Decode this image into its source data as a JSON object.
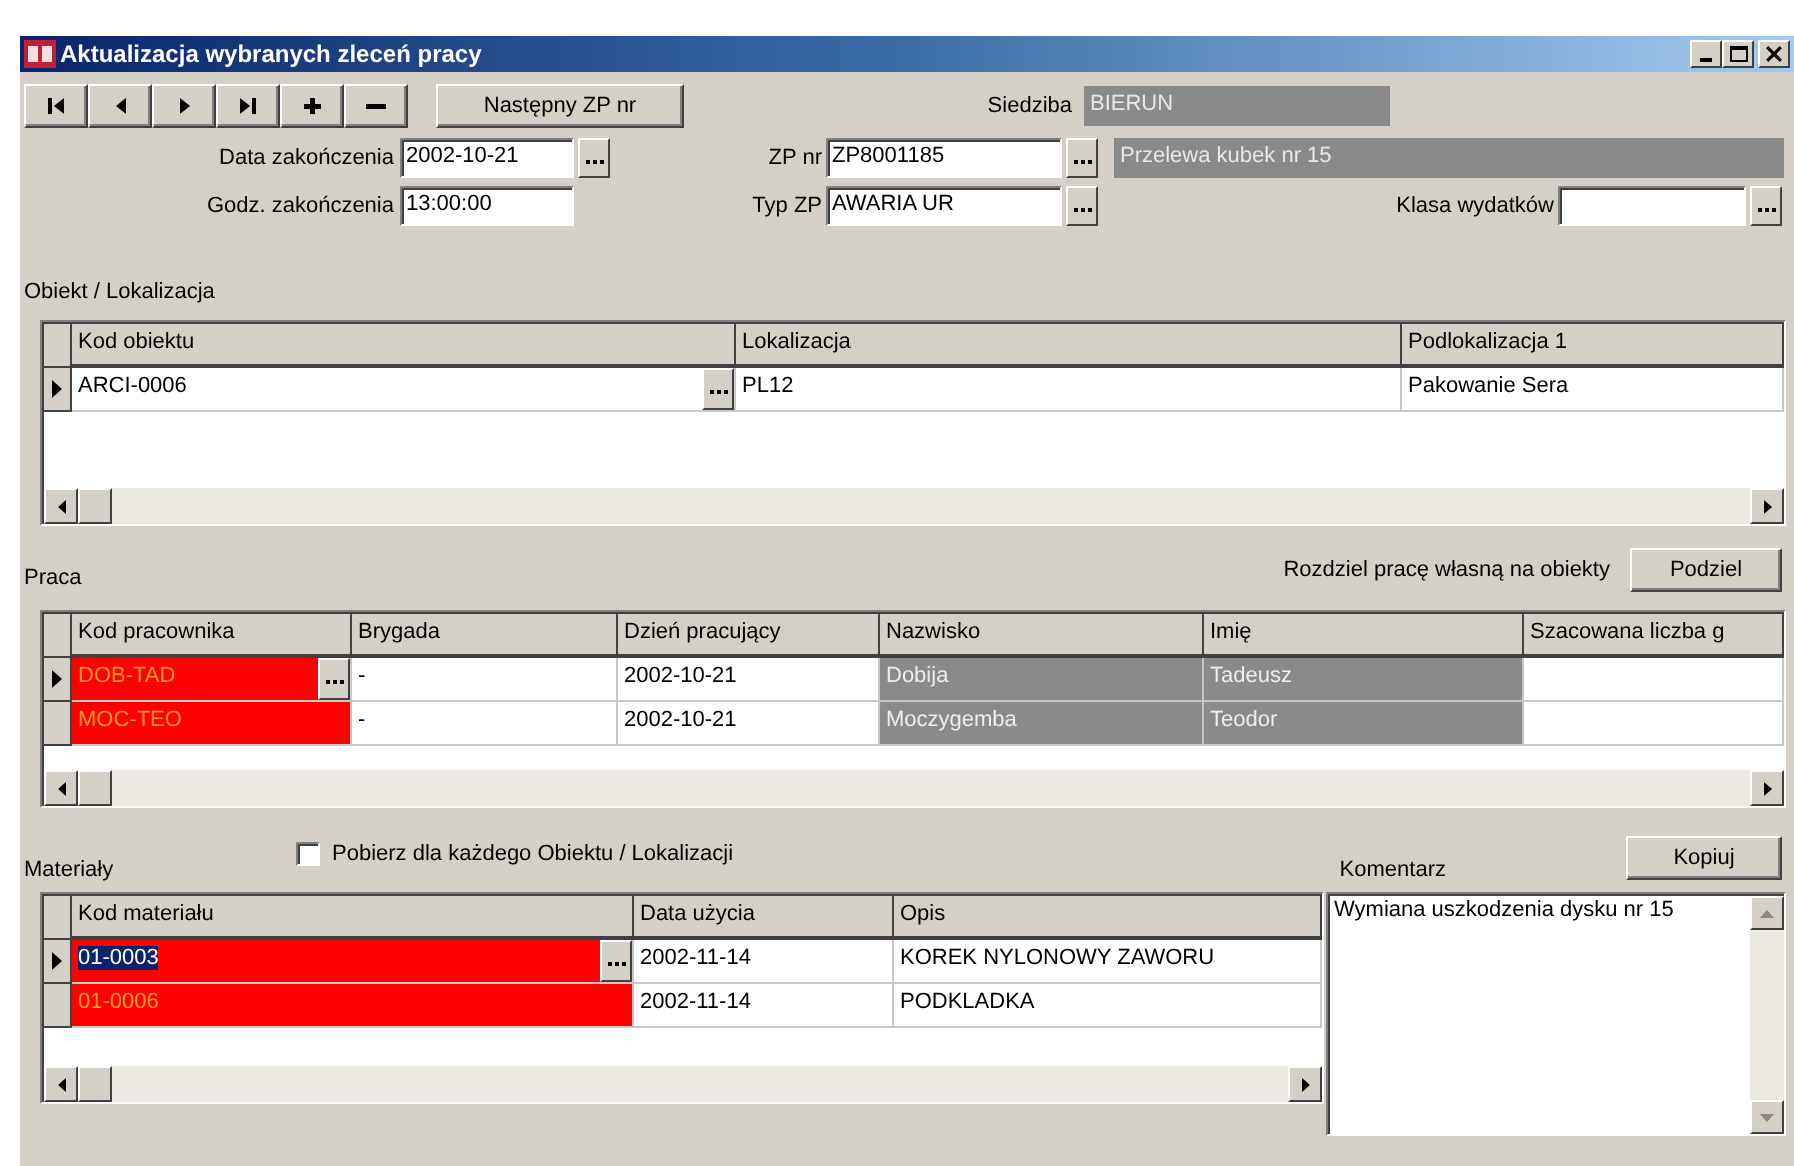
{
  "window": {
    "title": "Aktualizacja wybranych zleceń pracy"
  },
  "nav_buttons": [
    {
      "kind": "first"
    },
    {
      "kind": "prev"
    },
    {
      "kind": "next"
    },
    {
      "kind": "last"
    },
    {
      "kind": "add"
    },
    {
      "kind": "remove"
    }
  ],
  "next_order_button": "Następny ZP nr",
  "site": {
    "label": "Siedziba",
    "value": "BIERUN"
  },
  "end_date": {
    "label": "Data zakończenia",
    "value": "2002-10-21"
  },
  "end_time": {
    "label": "Godz. zakończenia",
    "value": "13:00:00"
  },
  "order_no": {
    "label": "ZP nr",
    "value": "ZP8001185",
    "description": "Przelewa kubek nr 15"
  },
  "order_type": {
    "label": "Typ ZP",
    "value": "AWARIA UR"
  },
  "expense_class": {
    "label": "Klasa wydatków"
  },
  "objects": {
    "title": "Obiekt / Lokalizacja",
    "table": {
      "columns": [
        "Kod obiektu",
        "Lokalizacja",
        "Podlokalizacja 1"
      ],
      "rows": [
        {
          "selected": true,
          "cells": [
            {
              "text": "ARCI-0006",
              "kind": "normal",
              "lookup": true
            },
            {
              "text": "PL12",
              "kind": "normal",
              "lookup": false
            },
            {
              "text": "Pakowanie Sera",
              "kind": "normal",
              "lookup": false
            }
          ]
        }
      ]
    }
  },
  "work": {
    "title": "Praca",
    "split_label": "Rozdziel pracę własną na obiekty",
    "split_button": "Podziel",
    "table": {
      "columns": [
        "Kod pracownika",
        "Brygada",
        "Dzień pracujący",
        "Nazwisko",
        "Imię",
        "Szacowana liczba g"
      ],
      "rows": [
        {
          "selected": true,
          "cells": [
            {
              "text": "DOB-TAD",
              "kind": "error",
              "lookup": true
            },
            {
              "text": "-",
              "kind": "normal",
              "lookup": false
            },
            {
              "text": "2002-10-21",
              "kind": "normal",
              "lookup": false
            },
            {
              "text": "Dobija",
              "kind": "readonly",
              "lookup": false
            },
            {
              "text": "Tadeusz",
              "kind": "readonly",
              "lookup": false
            },
            {
              "kind": "normal",
              "lookup": false
            }
          ]
        },
        {
          "selected": false,
          "cells": [
            {
              "text": "MOC-TEO",
              "kind": "error",
              "lookup": false
            },
            {
              "text": "-",
              "kind": "normal",
              "lookup": false
            },
            {
              "text": "2002-10-21",
              "kind": "normal",
              "lookup": false
            },
            {
              "text": "Moczygemba",
              "kind": "readonly",
              "lookup": false
            },
            {
              "text": "Teodor",
              "kind": "readonly",
              "lookup": false
            },
            {
              "kind": "normal",
              "lookup": false
            }
          ]
        }
      ]
    }
  },
  "materials": {
    "title": "Materiały",
    "per_object": {
      "label": "Pobierz dla każdego Obiektu / Lokalizacji",
      "checked": false
    },
    "table": {
      "columns": [
        "Kod materiału",
        "Data użycia",
        "Opis"
      ],
      "rows": [
        {
          "selected": true,
          "cells": [
            {
              "text": "01-0003",
              "kind": "error-selected",
              "lookup": true
            },
            {
              "text": "2002-11-14",
              "kind": "normal",
              "lookup": false
            },
            {
              "text": "KOREK NYLONOWY ZAWORU",
              "kind": "normal",
              "lookup": false
            }
          ]
        },
        {
          "selected": false,
          "cells": [
            {
              "text": "01-0006",
              "kind": "error",
              "lookup": false
            },
            {
              "text": "2002-11-14",
              "kind": "normal",
              "lookup": false
            },
            {
              "text": "PODKLADKA",
              "kind": "normal",
              "lookup": false
            }
          ]
        }
      ]
    }
  },
  "comment": {
    "title": "Komentarz",
    "copy_button": "Kopiuj",
    "text": "Wymiana uszkodzenia dysku nr 15"
  }
}
